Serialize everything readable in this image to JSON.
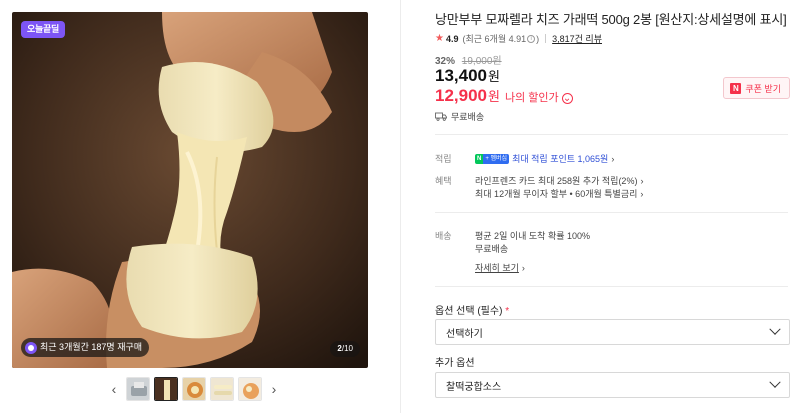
{
  "gallery": {
    "badge": "오늘끝딜",
    "repurchase_text": "최근 3개월간 187명 재구매",
    "counter_current": "2",
    "counter_total": "/10",
    "prev_icon": "chevron-left-icon",
    "next_icon": "chevron-right-icon"
  },
  "product": {
    "title": "낭만부부 모짜렐라 치즈 가래떡 500g 2봉 [원산지:상세설명에 표시]",
    "rating": "4.9",
    "rating_detail_prefix": "(최근 6개월 4.91",
    "rating_detail_suffix": ")",
    "review_count": "3,817건 리뷰",
    "discount_pct": "32%",
    "original_price": "19,000원",
    "price": "13,400",
    "price_unit": "원",
    "my_price": "12,900",
    "my_price_unit": "원",
    "my_price_label": "나의 할인가",
    "coupon_label": "쿠폰 받기",
    "shipping": "무료배송"
  },
  "benefits": {
    "points_label": "적립",
    "points_badge_n": "N",
    "points_badge_plus": "+ 멤버십",
    "points_text": "최대 적립 포인트 1,065원",
    "perks_label": "혜택",
    "perk_1": "라인프렌즈 카드 최대 258원 추가 적립(2%)",
    "perk_2": "최대 12개월 무이자 할부 • 60개월 특별금리"
  },
  "delivery": {
    "label": "배송",
    "line_1": "평균 2일 이내 도착 확률 100%",
    "line_2": "무료배송",
    "detail_link": "자세히 보기"
  },
  "options": {
    "required_title": "옵션 선택 (필수)",
    "required_mark": "*",
    "required_value": "선택하기",
    "extra_title": "추가 옵션",
    "extra_value": "찰떡궁합소스"
  },
  "colors": {
    "accent_red": "#f5314b",
    "badge_purple": "#7d55f5",
    "naver_green": "#03c75a"
  }
}
